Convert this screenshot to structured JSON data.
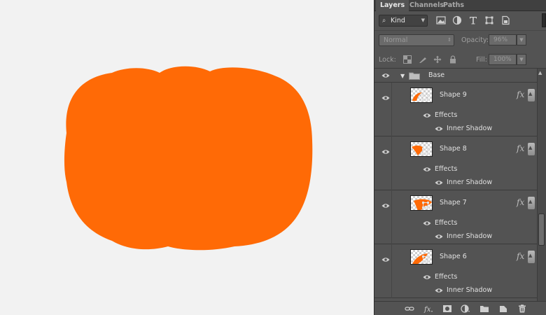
{
  "canvas": {
    "background_color": "#f2f2f2",
    "shape_color": "#ff6a06"
  },
  "panel": {
    "tabs": [
      "Layers",
      "Channels",
      "Paths"
    ],
    "active_tab": "Layers",
    "filter": {
      "kind_label": "Kind",
      "filter_icons": [
        "image-filter-icon",
        "adjustment-filter-icon",
        "type-filter-icon",
        "shape-filter-icon",
        "smart-object-filter-icon"
      ]
    },
    "blend_mode": "Normal",
    "opacity_label": "Opacity:",
    "opacity_value": "96%",
    "lock_label": "Lock:",
    "fill_label": "Fill:",
    "fill_value": "100%",
    "group": {
      "name": "Base"
    },
    "layers": [
      {
        "name": "Shape 9",
        "effects_label": "Effects",
        "effect_name": "Inner Shadow",
        "fx": "fx"
      },
      {
        "name": "Shape 8",
        "effects_label": "Effects",
        "effect_name": "Inner Shadow",
        "fx": "fx"
      },
      {
        "name": "Shape 7",
        "effects_label": "Effects",
        "effect_name": "Inner Shadow",
        "fx": "fx"
      },
      {
        "name": "Shape 6",
        "effects_label": "Effects",
        "effect_name": "Inner Shadow",
        "fx": "fx"
      }
    ],
    "bottom_icons": [
      "link-layers-icon",
      "add-layer-style-icon",
      "add-mask-icon",
      "new-adjustment-layer-icon",
      "new-group-icon",
      "new-layer-icon",
      "delete-layer-icon"
    ]
  }
}
